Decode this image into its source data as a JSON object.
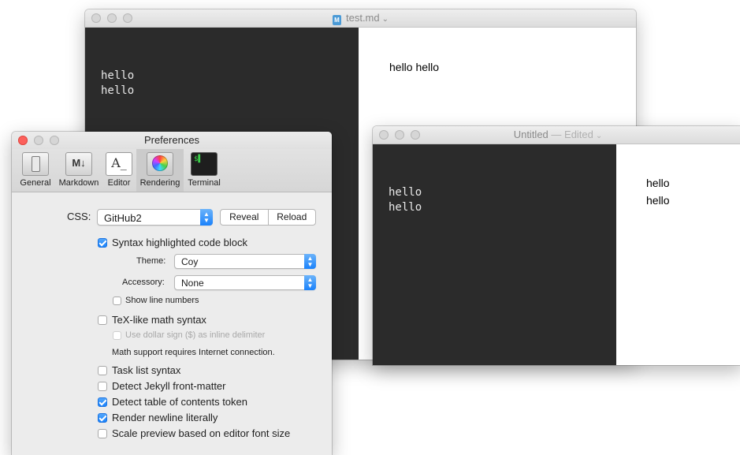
{
  "doc1": {
    "title": "test.md",
    "file_icon": "markdown-file-icon",
    "editor_lines": [
      "hello",
      "hello"
    ],
    "preview_text": "hello hello"
  },
  "doc2": {
    "title": "Untitled",
    "title_suffix": "— Edited",
    "editor_lines": [
      "hello",
      "hello"
    ],
    "preview_lines": [
      "hello",
      "hello"
    ]
  },
  "prefs": {
    "title": "Preferences",
    "tabs": [
      {
        "label": "General",
        "icon": "switch-icon"
      },
      {
        "label": "Markdown",
        "icon": "markdown-icon"
      },
      {
        "label": "Editor",
        "icon": "text-editor-icon"
      },
      {
        "label": "Rendering",
        "icon": "color-wheel-icon"
      },
      {
        "label": "Terminal",
        "icon": "terminal-icon"
      }
    ],
    "active_tab": "Rendering",
    "css_label": "CSS:",
    "css_value": "GitHub2",
    "reveal_label": "Reveal",
    "reload_label": "Reload",
    "syntax_label": "Syntax highlighted code block",
    "syntax_checked": true,
    "theme_label": "Theme:",
    "theme_value": "Coy",
    "accessory_label": "Accessory:",
    "accessory_value": "None",
    "line_numbers_label": "Show line numbers",
    "line_numbers_checked": false,
    "tex_label": "TeX-like math syntax",
    "tex_checked": false,
    "dollar_label": "Use dollar sign ($) as inline delimiter",
    "dollar_checked": false,
    "math_note": "Math support requires Internet connection.",
    "options": [
      {
        "label": "Task list syntax",
        "checked": false
      },
      {
        "label": "Detect Jekyll front-matter",
        "checked": false
      },
      {
        "label": "Detect table of contents token",
        "checked": true
      },
      {
        "label": "Render newline literally",
        "checked": true
      },
      {
        "label": "Scale preview based on editor font size",
        "checked": false
      }
    ],
    "colors": {
      "accent": "#1a82fb",
      "close": "#fc605b"
    }
  }
}
